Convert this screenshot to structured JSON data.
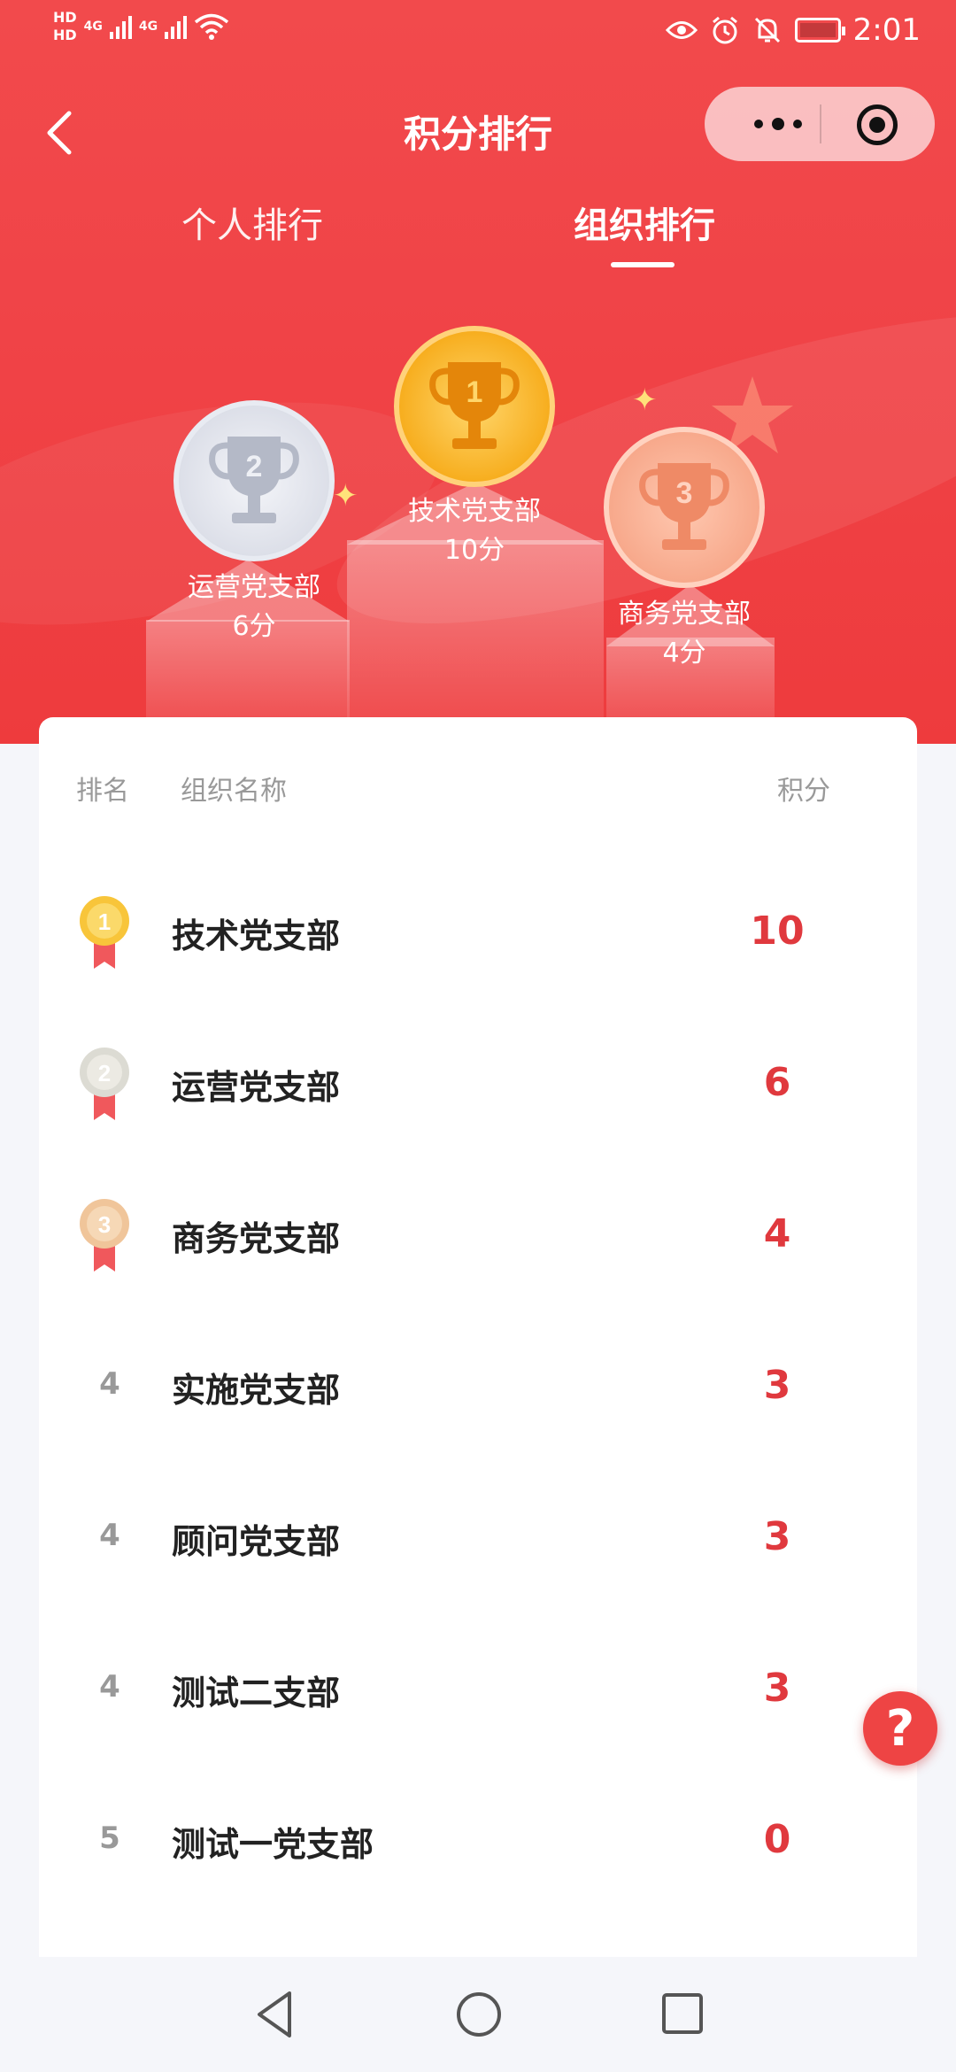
{
  "status_bar": {
    "hd1": "HD",
    "hd2": "HD",
    "net1": "4G",
    "net2": "4G",
    "time": "2:01"
  },
  "nav": {
    "title": "积分排行"
  },
  "tabs": [
    {
      "label": "个人排行",
      "active": false
    },
    {
      "label": "组织排行",
      "active": true
    }
  ],
  "podium": {
    "first": {
      "rank": "1",
      "name": "技术党支部",
      "score": "10分"
    },
    "second": {
      "rank": "2",
      "name": "运营党支部",
      "score": "6分"
    },
    "third": {
      "rank": "3",
      "name": "商务党支部",
      "score": "4分"
    }
  },
  "table": {
    "headers": {
      "rank": "排名",
      "name": "组织名称",
      "score": "积分"
    },
    "rows": [
      {
        "rank": "1",
        "name": "技术党支部",
        "score": "10",
        "medal": "gold"
      },
      {
        "rank": "2",
        "name": "运营党支部",
        "score": "6",
        "medal": "silver"
      },
      {
        "rank": "3",
        "name": "商务党支部",
        "score": "4",
        "medal": "bronze"
      },
      {
        "rank": "4",
        "name": "实施党支部",
        "score": "3"
      },
      {
        "rank": "4",
        "name": "顾问党支部",
        "score": "3"
      },
      {
        "rank": "4",
        "name": "测试二支部",
        "score": "3"
      },
      {
        "rank": "5",
        "name": "测试一党支部",
        "score": "0"
      }
    ]
  },
  "help_button": {
    "label": "?"
  },
  "colors": {
    "primary_red": "#ef4446",
    "score_red": "#e0393e",
    "gold": "#f7ae1f",
    "silver": "#d9dce6",
    "bronze": "#f6a486"
  }
}
